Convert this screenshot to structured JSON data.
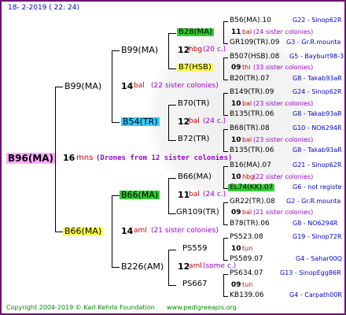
{
  "header": {
    "date": "18-  2-2019 ( 22: 24)"
  },
  "footer": {
    "copyright": "Copyright 2004-2019 © Karl Kehrle Foundation",
    "site": "www.pedigreeapis.org"
  },
  "root": {
    "id": "B96(MA)",
    "num": "16",
    "mns": "mns",
    "note": "(Drones from 12 sister colonies)"
  },
  "l1": [
    {
      "id": "B99(MA)",
      "num": "14",
      "bal": "bal",
      "note": "(22 sister colonies)"
    },
    {
      "id": "B66(MA)",
      "num": "14",
      "bal": "aml",
      "note": "(21 sister colonies)"
    }
  ],
  "l2": [
    {
      "id": "B99(MA)",
      "num": "12",
      "bal": "hbg",
      "note": "(20 c.)"
    },
    {
      "id": "B54(TR)",
      "num": "12",
      "bal": "bal",
      "note": "(24 c.)"
    },
    {
      "id": "B66(MA)",
      "num": "11",
      "bal": "bal",
      "note": "(24 c.)"
    },
    {
      "id": "B226(AM)",
      "num": "12",
      "bal": "aml",
      "note": "(some c.)"
    }
  ],
  "l3": [
    {
      "queen": "B28(MA)",
      "drone": "B7(HSB)"
    },
    {
      "queen": "B70(TR)",
      "drone": "B72(TR)"
    },
    {
      "queen": "B66(MA)",
      "drone": "GR109(TR)"
    },
    {
      "queen": "PS559",
      "drone": "PS667"
    }
  ],
  "l4": [
    {
      "id": "B56(MA).10",
      "num": "",
      "bal": "",
      "note": "",
      "ref": "G22 - Sinop62R"
    },
    {
      "id": "",
      "num": "11",
      "bal": "bal",
      "note": "(24 sister colonies)",
      "ref": ""
    },
    {
      "id": "GR109(TR).09",
      "num": "",
      "bal": "",
      "note": "",
      "ref": "G3 - Gr.R.mounta"
    },
    {
      "id": "B507(HSB).08",
      "num": "",
      "bal": "",
      "note": "",
      "ref": "G5 - Bayburt98-3"
    },
    {
      "id": "",
      "num": "09",
      "bal": "thi",
      "note": "(33 sister colonies)",
      "ref": ""
    },
    {
      "id": "B20(TR).07",
      "num": "",
      "bal": "",
      "note": "",
      "ref": "G8 - Takab93aR"
    },
    {
      "id": "B149(TR).09",
      "num": "",
      "bal": "",
      "note": "",
      "ref": "G24 - Sinop62R"
    },
    {
      "id": "",
      "num": "10",
      "bal": "bal",
      "note": "(23 sister colonies)",
      "ref": ""
    },
    {
      "id": "B135(TR).06",
      "num": "",
      "bal": "",
      "note": "",
      "ref": "G8 - Takab93aR"
    },
    {
      "id": "B68(TR).08",
      "num": "",
      "bal": "",
      "note": "",
      "ref": "G10 - NO6294R"
    },
    {
      "id": "",
      "num": "10",
      "bal": "bal",
      "note": "(23 sister colonies)",
      "ref": ""
    },
    {
      "id": "B135(TR).06",
      "num": "",
      "bal": "",
      "note": "",
      "ref": "G8 - Takab93aR"
    },
    {
      "id": "B16(MA).07",
      "num": "",
      "bal": "",
      "note": "",
      "ref": "G21 - Sinop62R"
    },
    {
      "id": "",
      "num": "10",
      "bal": "hbg",
      "note": "(22 sister colonies)",
      "ref": ""
    },
    {
      "id": "EL74(KK).07",
      "num": "",
      "bal": "",
      "note": "",
      "ref": "G6 - not registe"
    },
    {
      "id": "GR22(TR).08",
      "num": "",
      "bal": "",
      "note": "",
      "ref": "G2 - Gr.R.mounta"
    },
    {
      "id": "",
      "num": "09",
      "bal": "bal",
      "note": "(21 sister colonies)",
      "ref": ""
    },
    {
      "id": "B78(TR).06",
      "num": "",
      "bal": "",
      "note": "",
      "ref": "G8 - NO6294R"
    },
    {
      "id": "PS523.08",
      "num": "",
      "bal": "",
      "note": "",
      "ref": "G19 - Sinop72R"
    },
    {
      "id": "",
      "num": "10",
      "bal": "tun",
      "note": "",
      "ref": ""
    },
    {
      "id": "PS589.07",
      "num": "",
      "bal": "",
      "note": "",
      "ref": "G4 - Sahar00Q"
    },
    {
      "id": "PS634.07",
      "num": "",
      "bal": "",
      "note": "",
      "ref": "G13 - SinopEgg86R"
    },
    {
      "id": "",
      "num": "09",
      "bal": "tun",
      "note": "",
      "ref": ""
    },
    {
      "id": "KB139.06",
      "num": "",
      "bal": "",
      "note": "",
      "ref": "G4 - Carpath00R"
    }
  ]
}
